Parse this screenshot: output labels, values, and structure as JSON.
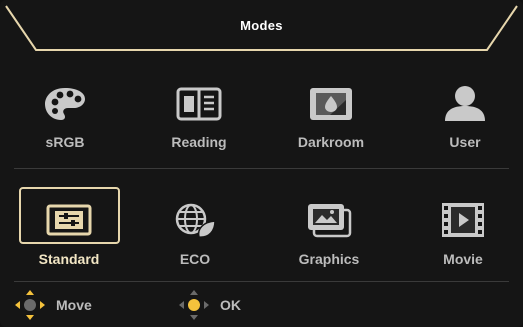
{
  "header": {
    "title": "Modes"
  },
  "modes_row1": [
    {
      "label": "sRGB",
      "icon": "palette-icon"
    },
    {
      "label": "Reading",
      "icon": "book-icon"
    },
    {
      "label": "Darkroom",
      "icon": "darkroom-icon"
    },
    {
      "label": "User",
      "icon": "user-icon"
    }
  ],
  "modes_row2": [
    {
      "label": "Standard",
      "icon": "sliders-icon",
      "selected": true
    },
    {
      "label": "ECO",
      "icon": "eco-globe-icon"
    },
    {
      "label": "Graphics",
      "icon": "graphics-icon"
    },
    {
      "label": "Movie",
      "icon": "film-icon"
    }
  ],
  "footer": {
    "move_label": "Move",
    "ok_label": "OK"
  },
  "colors": {
    "accent": "#e6d6ac",
    "joystick": "#f4c23c",
    "text": "#bcbcbc",
    "background": "#151515"
  }
}
